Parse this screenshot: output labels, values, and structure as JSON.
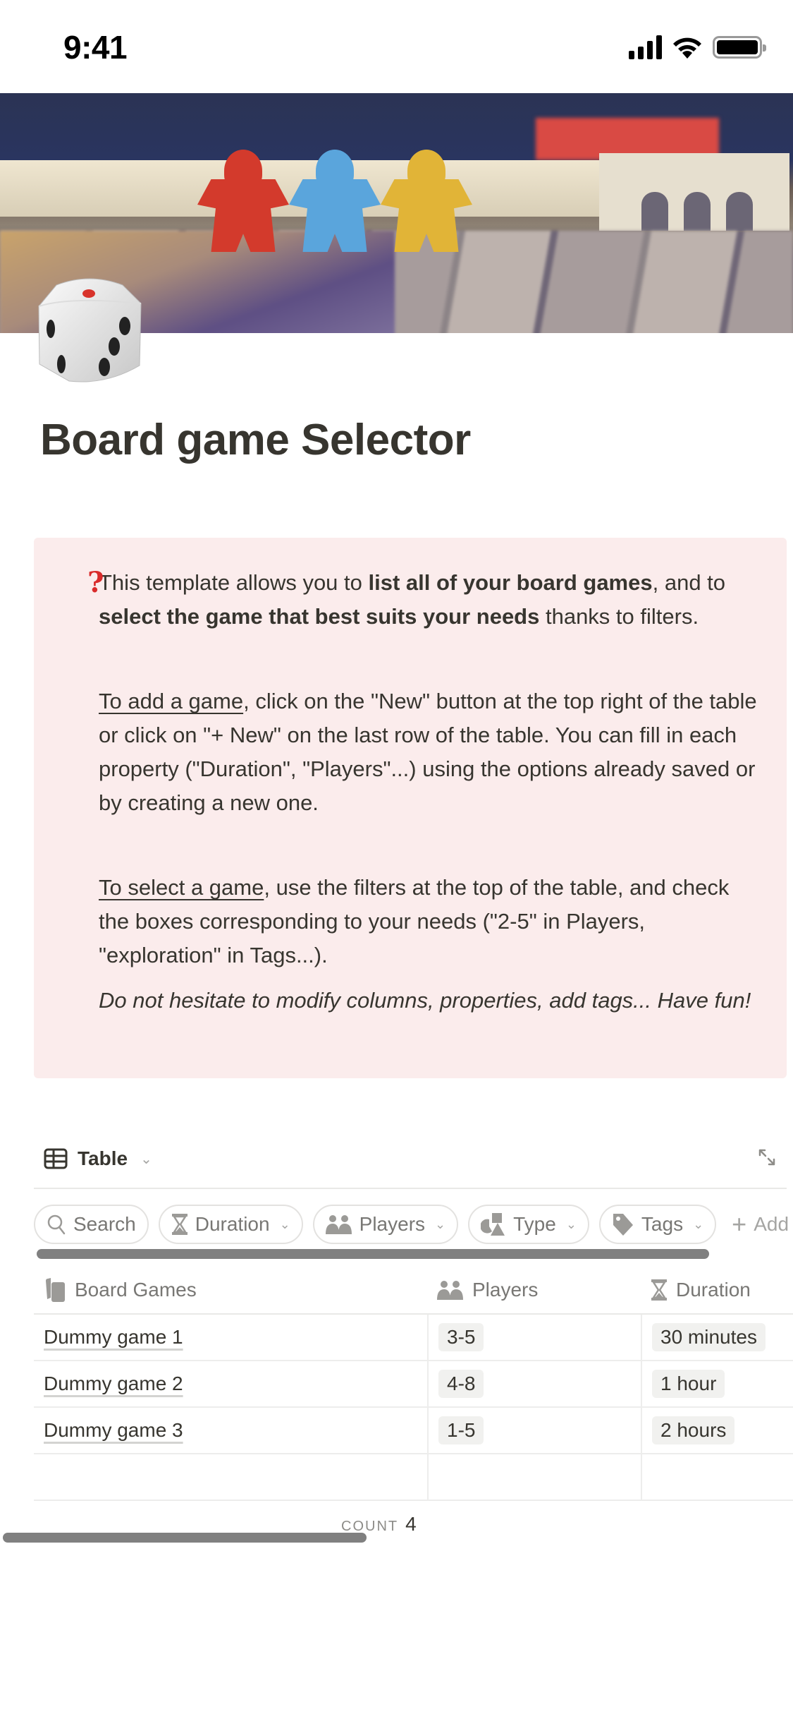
{
  "status_bar": {
    "time": "9:41"
  },
  "page": {
    "title": "Board game Selector",
    "icon": "dice-icon",
    "cover": "board-game-meeples-photo"
  },
  "callout": {
    "icon": "question-mark-icon",
    "icon_color": "#d92b2b",
    "background": "#fbecec",
    "p1_a": "This template allows you to ",
    "p1_b": "list all of your board games",
    "p1_c": ", and to ",
    "p1_d": "select the game that best suits your needs",
    "p1_e": " thanks to filters.",
    "p2_link": "To add a game",
    "p2_rest": ", click on the \"New\" button at the top right of the table or click on \"+ New\" on the last row of the table. You can fill in each property (\"Duration\", \"Players\"...) using the options already saved or by creating a new one.",
    "p3_link": "To select a game",
    "p3_rest": ", use the filters at the top of the table, and check the boxes corresponding to your needs (\"2-5\" in Players, \"exploration\" in Tags...).",
    "p4": "Do not hesitate to modify columns, properties, add tags... Have fun!"
  },
  "view": {
    "tab_label": "Table",
    "tab_icon": "table-icon",
    "expand_icon": "expand-icon"
  },
  "filters": {
    "search": "Search",
    "chips": [
      {
        "label": "Duration",
        "icon": "hourglass-icon"
      },
      {
        "label": "Players",
        "icon": "people-icon"
      },
      {
        "label": "Type",
        "icon": "shapes-icon"
      },
      {
        "label": "Tags",
        "icon": "tag-icon"
      }
    ],
    "add_filter": "Add filter"
  },
  "table": {
    "columns": [
      {
        "label": "Board Games",
        "icon": "cards-icon"
      },
      {
        "label": "Players",
        "icon": "people-icon"
      },
      {
        "label": "Duration",
        "icon": "hourglass-icon"
      }
    ],
    "rows": [
      {
        "name": "Dummy game 1",
        "players": "3-5",
        "duration": "30 minutes"
      },
      {
        "name": "Dummy game 2",
        "players": "4-8",
        "duration": "1 hour"
      },
      {
        "name": "Dummy game 3",
        "players": "1-5",
        "duration": "2 hours"
      }
    ],
    "count_label": "COUNT",
    "count_value": "4"
  }
}
